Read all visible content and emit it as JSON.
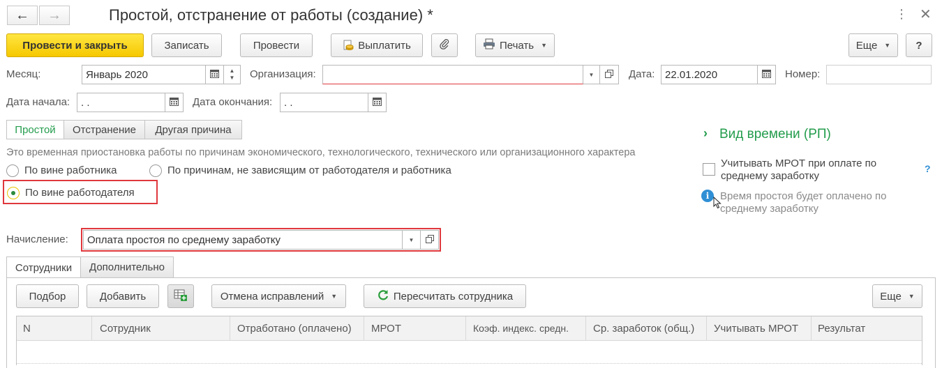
{
  "header": {
    "title": "Простой, отстранение от работы (создание) *",
    "back_icon": "←",
    "forward_icon": "→"
  },
  "toolbar": {
    "post_close": "Провести и закрыть",
    "save": "Записать",
    "post": "Провести",
    "pay": "Выплатить",
    "print": "Печать",
    "more": "Еще",
    "help": "?"
  },
  "form": {
    "month_label": "Месяц:",
    "month_value": "Январь 2020",
    "org_label": "Организация:",
    "org_value": "",
    "date_label": "Дата:",
    "date_value": "22.01.2020",
    "number_label": "Номер:",
    "number_value": "",
    "start_label": "Дата начала:",
    "start_value": " .  .",
    "end_label": "Дата окончания:",
    "end_value": " .  ."
  },
  "reason_tabs": [
    {
      "label": "Простой",
      "active": true
    },
    {
      "label": "Отстранение",
      "active": false
    },
    {
      "label": "Другая причина",
      "active": false
    }
  ],
  "description": "Это временная приостановка работы по причинам экономического, технологического, технического или организационного характера",
  "radios": {
    "employee": "По вине работника",
    "independent": "По причинам, не зависящим от работодателя и работника",
    "employer": "По вине работодателя",
    "selected": "employer"
  },
  "accrual": {
    "label": "Начисление:",
    "value": "Оплата простоя по среднему заработку"
  },
  "right_panel": {
    "time_type": "Вид времени (РП)",
    "mrot_checkbox": "Учитывать МРОТ при оплате по среднему заработку",
    "mrot_checked": false,
    "help": "?",
    "info": "Время простоя будет оплачено по среднему заработку"
  },
  "bottom_tabs": [
    {
      "label": "Сотрудники",
      "active": true
    },
    {
      "label": "Дополнительно",
      "active": false
    }
  ],
  "table_toolbar": {
    "pick": "Подбор",
    "add": "Добавить",
    "cancel_fix": "Отмена исправлений",
    "recalc": "Пересчитать сотрудника",
    "more": "Еще"
  },
  "table": {
    "columns": [
      "N",
      "Сотрудник",
      "Отработано (оплачено)",
      "МРОТ",
      "Коэф. индекс. средн.",
      "Ср. заработок (общ.)",
      "Учитывать МРОТ",
      "Результат"
    ],
    "rows": []
  },
  "colors": {
    "primary_button": "#f6c800",
    "active_green": "#239c4c",
    "highlight_red": "#e0383d",
    "info_blue": "#2f8fd5"
  }
}
